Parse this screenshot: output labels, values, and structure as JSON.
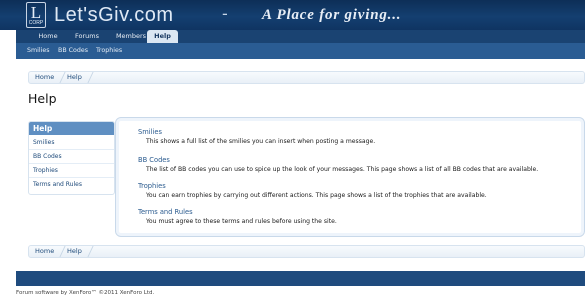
{
  "site": {
    "logo_glyph": "L",
    "logo_sub": "CORP",
    "name": "Let'sGiv.com",
    "dash": "-",
    "tagline": "A Place for giving..."
  },
  "nav": {
    "tabs": [
      {
        "label": "Home"
      },
      {
        "label": "Forums"
      },
      {
        "label": "Members"
      },
      {
        "label": "Help",
        "active": true
      }
    ]
  },
  "subnav": {
    "links": [
      {
        "label": "Smilies"
      },
      {
        "label": "BB Codes"
      },
      {
        "label": "Trophies"
      }
    ]
  },
  "breadcrumb": {
    "items": [
      {
        "label": "Home"
      },
      {
        "label": "Help"
      }
    ]
  },
  "page": {
    "title": "Help"
  },
  "sidebar": {
    "heading": "Help",
    "items": [
      {
        "label": "Smilies"
      },
      {
        "label": "BB Codes"
      },
      {
        "label": "Trophies"
      },
      {
        "label": "Terms and Rules"
      }
    ]
  },
  "topics": [
    {
      "title": "Smilies",
      "desc": "This shows a full list of the smilies you can insert when posting a message."
    },
    {
      "title": "BB Codes",
      "desc": "The list of BB codes you can use to spice up the look of your messages. This page shows a list of all BB codes that are available."
    },
    {
      "title": "Trophies",
      "desc": "You can earn trophies by carrying out different actions. This page shows a list of the trophies that are available."
    },
    {
      "title": "Terms and Rules",
      "desc": "You must agree to these terms and rules before using the site."
    }
  ],
  "footer": {
    "text": "Forum software by XenForo™ ©2011 XenForo Ltd."
  }
}
